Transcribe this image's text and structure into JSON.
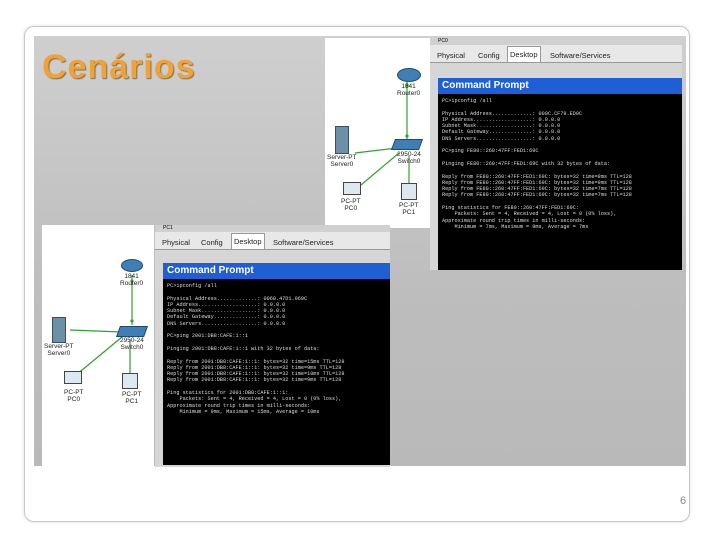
{
  "slide": {
    "title": "Cenários",
    "page_number": "6"
  },
  "window_top": {
    "titlebar": "PC0",
    "tabs": [
      "Physical",
      "Config",
      "Desktop",
      "Software/Services"
    ],
    "active_tab": "Desktop",
    "cmd_title": "Command Prompt",
    "cmd_lines": [
      "PC>ipconfig /all",
      "",
      "Physical Address.............: 000C.CF79.ED0C",
      "IP Address...................: 0.0.0.0",
      "Subnet Mask..................: 0.0.0.0",
      "Default Gateway..............: 0.0.0.0",
      "DNS Servers..................: 0.0.0.0",
      "",
      "PC>ping FE80::260:47FF:FED1:69C",
      "",
      "Pinging FE80::260:47FF:FED1:69C with 32 bytes of data:",
      "",
      "Reply from FE80::260:47FF:FED1:69C: bytes=32 time=8ms TTL=128",
      "Reply from FE80::260:47FF:FED1:69C: bytes=32 time=9ms TTL=128",
      "Reply from FE80::260:47FF:FED1:69C: bytes=32 time=7ms TTL=128",
      "Reply from FE80::260:47FF:FED1:69C: bytes=32 time=7ms TTL=128",
      "",
      "Ping statistics for FE80::260:47FF:FED1:69C:",
      "    Packets: Sent = 4, Received = 4, Lost = 0 (0% loss),",
      "Approximate round trip times in milli-seconds:",
      "    Minimum = 7ms, Maximum = 9ms, Average = 7ms"
    ]
  },
  "window_bottom": {
    "titlebar": "PC1",
    "tabs": [
      "Physical",
      "Config",
      "Desktop",
      "Software/Services"
    ],
    "active_tab": "Desktop",
    "cmd_title": "Command Prompt",
    "cmd_lines": [
      "PC>ipconfig /all",
      "",
      "Physical Address.............: 0060.47D1.069C",
      "IP Address...................: 0.0.0.0",
      "Subnet Mask..................: 0.0.0.0",
      "Default Gateway..............: 0.0.0.0",
      "DNS Servers..................: 0.0.0.0",
      "",
      "PC>ping 2001:DB8:CAFE:1::1",
      "",
      "Pinging 2001:DB8:CAFE:1::1 with 32 bytes of data:",
      "",
      "Reply from 2001:DB8:CAFE:1::1: bytes=32 time=15ms TTL=128",
      "Reply from 2001:DB8:CAFE:1::1: bytes=32 time=9ms TTL=128",
      "Reply from 2001:DB8:CAFE:1::1: bytes=32 time=10ms TTL=128",
      "Reply from 2001:DB8:CAFE:1::1: bytes=32 time=9ms TTL=128",
      "",
      "Ping statistics for 2001:DB8:CAFE:1::1:",
      "    Packets: Sent = 4, Received = 4, Lost = 0 (0% loss),",
      "Approximate round trip times in milli-seconds:",
      "    Minimum = 9ms, Maximum = 15ms, Average = 10ms"
    ]
  },
  "topology_top": {
    "router": "1841\nRouter0",
    "switch": "2950-24\nSwitch0",
    "server": "Server-PT\nServer0",
    "pc0": "PC-PT\nPC0",
    "pc1": "PC-PT\nPC1"
  },
  "topology_bottom": {
    "router": "1841\nRouter0",
    "switch": "2950-24\nSwitch0",
    "server": "Server-PT\nServer0",
    "pc0": "PC-PT\nPC0",
    "pc1": "PC-PT\nPC1"
  },
  "colors": {
    "title": "#f0a23a",
    "cmd_header": "#1e5fd6",
    "link": "#2ea32e"
  }
}
